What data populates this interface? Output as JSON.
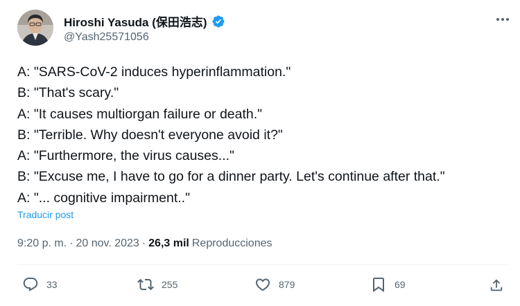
{
  "author": {
    "display_name": "Hiroshi Yasuda (保田浩志)",
    "handle": "@Yash25571056",
    "verified": true,
    "avatar_icon": "user-avatar"
  },
  "tweet": {
    "lines": [
      "A: \"SARS-CoV-2 induces hyperinflammation.\"",
      "B: \"That's scary.\"",
      "A: \"It causes multiorgan failure or death.\"",
      "B: \"Terrible. Why doesn't everyone avoid it?\"",
      "A: \"Furthermore, the virus causes...\"",
      "B: \"Excuse me, I have to go for a dinner party. Let's continue after that.\"",
      "A: \"... cognitive impairment..\""
    ],
    "translate_label": "Traducir post"
  },
  "meta": {
    "time": "9:20 p. m.",
    "separator": "·",
    "date": "20 nov. 2023",
    "views_count": "26,3 mil",
    "views_label": "Reproducciones"
  },
  "actions": {
    "replies": "33",
    "reposts": "255",
    "likes": "879",
    "bookmarks": "69"
  },
  "colors": {
    "accent": "#1d9bf0",
    "secondary_text": "#536471",
    "primary_text": "#0f1419"
  }
}
